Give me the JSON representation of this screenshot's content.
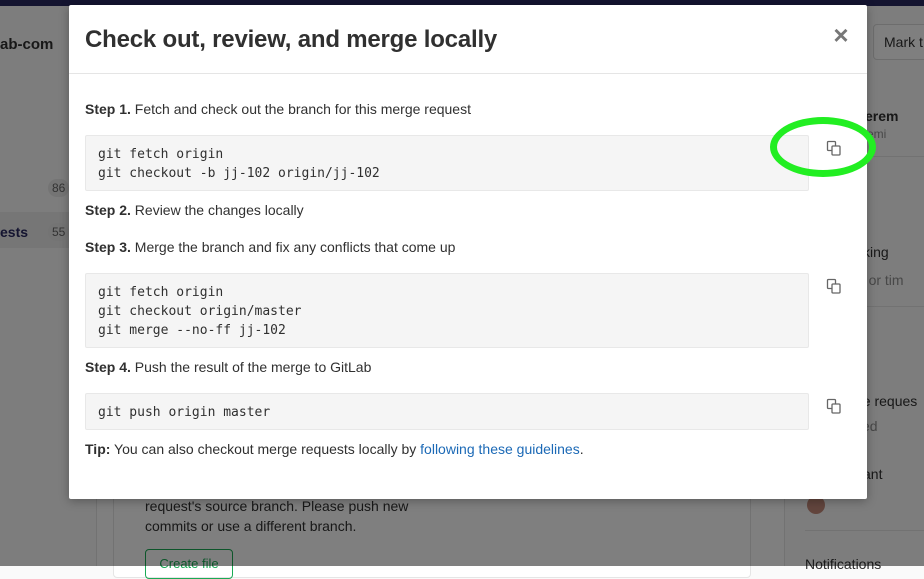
{
  "background": {
    "project_name": "ab-com",
    "sidebar_counts": [
      "86",
      "55"
    ],
    "sidebar_active_label": "ests",
    "mark_button": "Mark t",
    "right_texts": [
      "an Jerem",
      "njeremi",
      "king",
      "te or tim",
      "ge reques",
      "ked",
      "ant",
      "Notifications"
    ],
    "card_text": "request's source branch. Please push new commits or use a different branch.",
    "card_button": "Create file"
  },
  "modal": {
    "title": "Check out, review, and merge locally",
    "close_icon": "×",
    "steps": [
      {
        "label": "Step 1.",
        "text": " Fetch and check out the branch for this merge request",
        "code": [
          "git fetch origin",
          "git checkout -b jj-102 origin/jj-102"
        ]
      },
      {
        "label": "Step 2.",
        "text": " Review the changes locally"
      },
      {
        "label": "Step 3.",
        "text": " Merge the branch and fix any conflicts that come up",
        "code": [
          "git fetch origin",
          "git checkout origin/master",
          "git merge --no-ff jj-102"
        ]
      },
      {
        "label": "Step 4.",
        "text": " Push the result of the merge to GitLab",
        "code": [
          "git push origin master"
        ]
      }
    ],
    "tip": {
      "label": "Tip:",
      "text": " You can also checkout merge requests locally by ",
      "link": "following these guidelines",
      "end": "."
    }
  },
  "colors": {
    "annotation": "#22ee22",
    "link": "#1b69b6",
    "code_bg": "#f5f5f5"
  },
  "icons": {
    "copy": "copy-icon",
    "close": "close-icon"
  }
}
